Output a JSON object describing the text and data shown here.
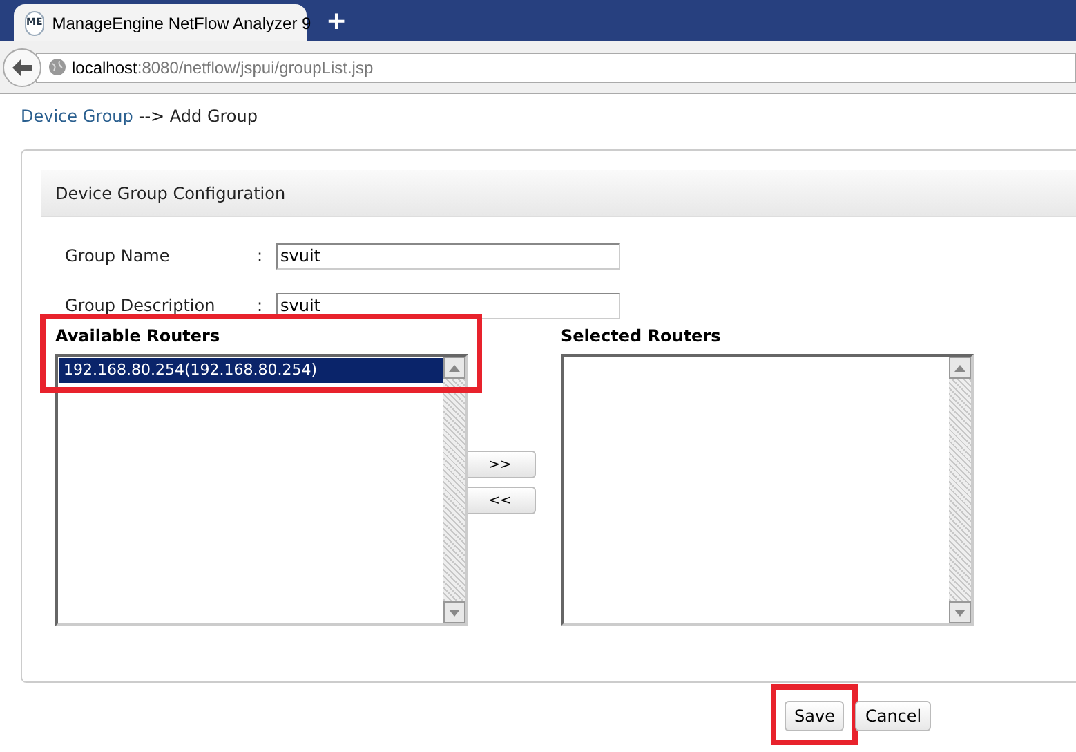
{
  "browser": {
    "tab": {
      "icon_text": "ME",
      "title": "ManageEngine NetFlow Analyzer 9",
      "selected": true
    },
    "new_tab": "+",
    "url_host": "localhost",
    "url_path": ":8080/netflow/jspui/groupList.jsp"
  },
  "breadcrumb": {
    "link": "Device Group",
    "rest": "--> Add Group"
  },
  "panel": {
    "title": "Device Group Configuration",
    "fields": [
      {
        "label": "Group Name",
        "separator": ":",
        "value": "svuit"
      },
      {
        "label": "Group Description",
        "separator": ":",
        "value": "svuit"
      }
    ],
    "available": {
      "title": "Available Routers",
      "items": [
        {
          "label": "192.168.80.254(192.168.80.254)",
          "selected": true
        }
      ],
      "highlighted": true
    },
    "move_buttons": [
      ">>",
      "<<"
    ],
    "selected": {
      "title": "Selected Routers",
      "highlighted": false
    }
  },
  "actions": [
    {
      "label": "Save",
      "highlighted": true
    },
    {
      "label": "Cancel",
      "highlighted": false
    }
  ]
}
